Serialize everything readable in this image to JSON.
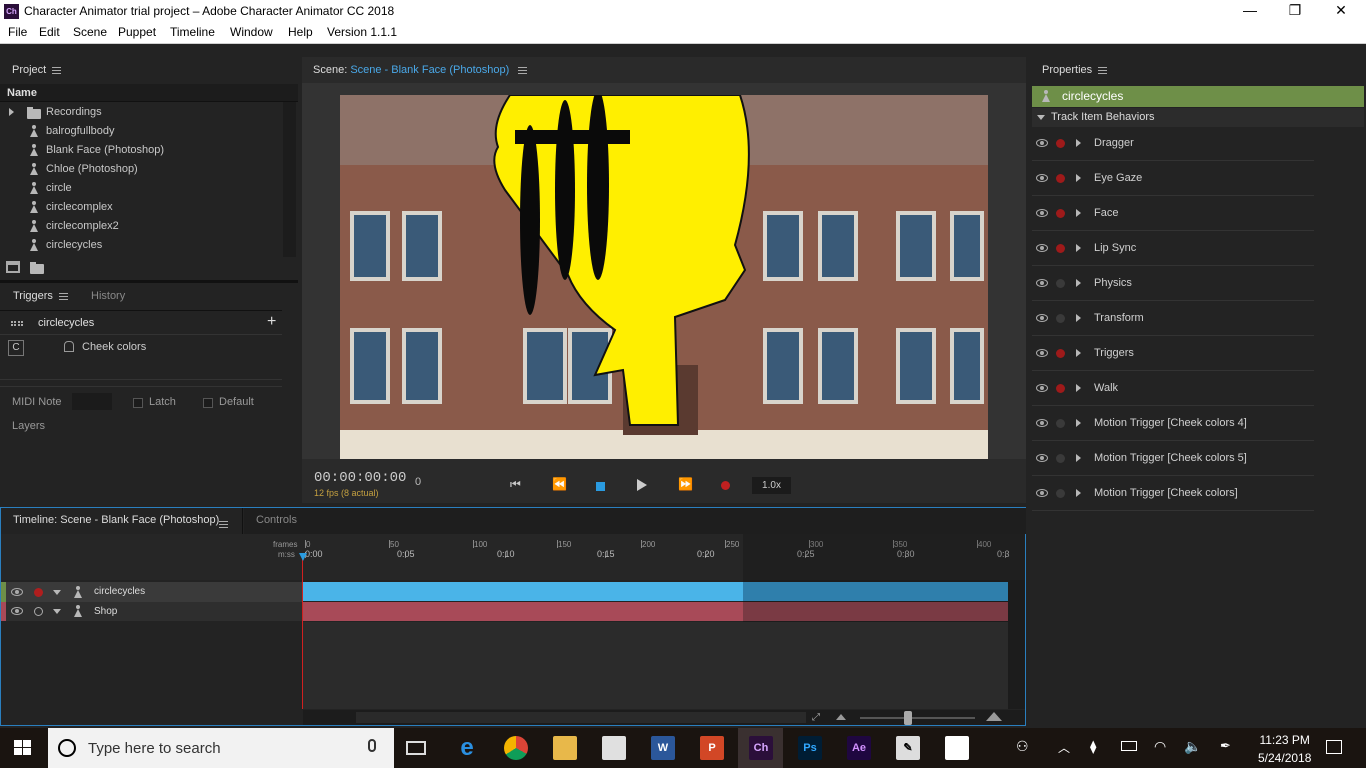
{
  "titlebar": {
    "app_icon": "Ch",
    "title": "Character Animator trial project – Adobe Character Animator CC 2018",
    "minimize": "—",
    "maximize": "❐",
    "close": "✕"
  },
  "menu": [
    "File",
    "Edit",
    "Scene",
    "Puppet",
    "Timeline",
    "Window",
    "Help",
    "Version 1.1.1"
  ],
  "project": {
    "title": "Project",
    "column": "Name",
    "items": [
      "Recordings",
      "balrogfullbody",
      "Blank Face (Photoshop)",
      "Chloe (Photoshop)",
      "circle",
      "circlecomplex",
      "circlecomplex2",
      "circlecycles"
    ]
  },
  "triggers": {
    "tab_active": "Triggers",
    "tab_inactive": "History",
    "puppet": "circlecycles",
    "key": "C",
    "trigger_name": "Cheek colors",
    "midi_label": "MIDI Note",
    "latch": "Latch",
    "default": "Default",
    "layers": "Layers"
  },
  "scene": {
    "prefix": "Scene:",
    "name": "Scene - Blank Face (Photoshop)",
    "timecode": "00:00:00:00",
    "frame": "0",
    "fps": "12 fps (8 actual)",
    "speed": "1.0x"
  },
  "properties": {
    "title": "Properties",
    "selected": "circlecycles",
    "section": "Track Item Behaviors",
    "behaviors": [
      {
        "name": "Dragger",
        "armed": true
      },
      {
        "name": "Eye Gaze",
        "armed": true
      },
      {
        "name": "Face",
        "armed": true
      },
      {
        "name": "Lip Sync",
        "armed": true
      },
      {
        "name": "Physics",
        "armed": false
      },
      {
        "name": "Transform",
        "armed": false
      },
      {
        "name": "Triggers",
        "armed": true
      },
      {
        "name": "Walk",
        "armed": true
      },
      {
        "name": "Motion Trigger [Cheek colors 4]",
        "armed": false
      },
      {
        "name": "Motion Trigger [Cheek colors 5]",
        "armed": false
      },
      {
        "name": "Motion Trigger [Cheek colors]",
        "armed": false
      }
    ]
  },
  "timeline": {
    "tab_active": "Timeline: Scene - Blank Face (Photoshop)",
    "tab_inactive": "Controls",
    "frames_label": "frames",
    "mss_label": "m:ss",
    "frame_ticks": [
      "0",
      "50",
      "100",
      "150",
      "200",
      "250",
      "300",
      "350",
      "400"
    ],
    "time_ticks": [
      "0:00",
      "0:05",
      "0:10",
      "0:15",
      "0:20",
      "0:25",
      "0:30",
      "0:3"
    ],
    "tracks": [
      {
        "name": "circlecycles",
        "color": "#4ab4e8"
      },
      {
        "name": "Shop",
        "color": "#a84a58"
      }
    ]
  },
  "taskbar": {
    "search_placeholder": "Type here to search",
    "time": "11:23 PM",
    "date": "5/24/2018",
    "apps": [
      "Ch",
      "Ps",
      "Ae",
      "W",
      "P"
    ]
  }
}
